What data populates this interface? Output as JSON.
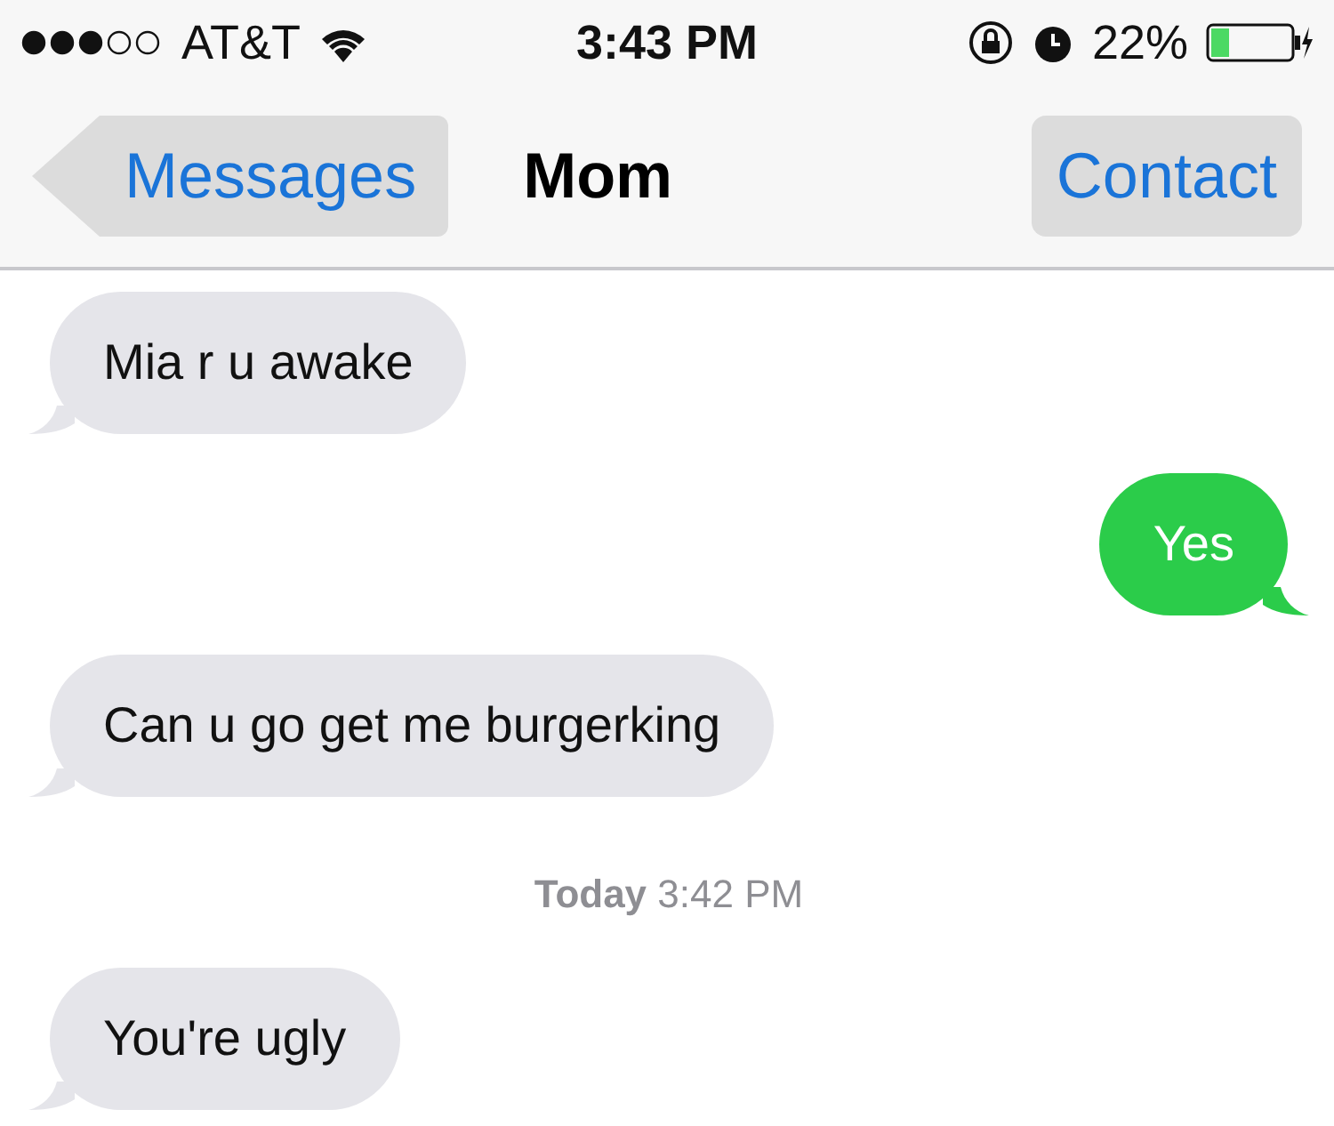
{
  "status_bar": {
    "carrier": "AT&T",
    "time": "3:43 PM",
    "battery": "22%"
  },
  "nav": {
    "back": "Messages",
    "title": "Mom",
    "action": "Contact"
  },
  "messages": [
    {
      "kind": "incoming",
      "text": "Mia r u awake"
    },
    {
      "kind": "outgoing",
      "text": "Yes"
    },
    {
      "kind": "incoming",
      "text": "Can u go get me burgerking"
    },
    {
      "kind": "timestamp",
      "text": "**Today** 3:42 PM"
    },
    {
      "kind": "incoming",
      "text": "You're ugly"
    }
  ]
}
